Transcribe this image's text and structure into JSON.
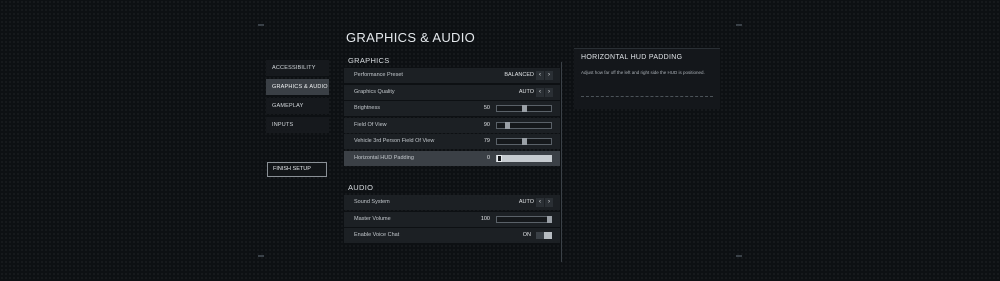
{
  "page": {
    "title": "GRAPHICS & AUDIO"
  },
  "nav": {
    "items": [
      {
        "label": "ACCESSIBILITY"
      },
      {
        "label": "GRAPHICS & AUDIO"
      },
      {
        "label": "GAMEPLAY"
      },
      {
        "label": "INPUTS"
      }
    ],
    "active_index": 1,
    "finish_label": "FINISH SETUP"
  },
  "graphics": {
    "heading": "GRAPHICS",
    "rows": [
      {
        "label": "Performance Preset",
        "value": "BALANCED",
        "type": "select"
      },
      {
        "label": "Graphics Quality",
        "value": "AUTO",
        "type": "select"
      },
      {
        "label": "Brightness",
        "value": "50",
        "type": "slider",
        "level": 0.5
      },
      {
        "label": "Field Of View",
        "value": "90",
        "type": "slider",
        "level": 0.18
      },
      {
        "label": "Vehicle 3rd Person Field Of View",
        "value": "79",
        "type": "slider",
        "level": 0.5
      },
      {
        "label": "Horizontal HUD Padding",
        "value": "0",
        "type": "slider",
        "level": 0.0
      }
    ]
  },
  "audio": {
    "heading": "AUDIO",
    "rows": [
      {
        "label": "Sound System",
        "value": "AUTO",
        "type": "select"
      },
      {
        "label": "Master Volume",
        "value": "100",
        "type": "slider",
        "level": 1.0
      },
      {
        "label": "Enable Voice Chat",
        "value": "ON",
        "type": "toggle"
      }
    ]
  },
  "info_panel": {
    "title": "HORIZONTAL HUD PADDING",
    "description": "Adjust how far off the left and right side the HUD is positioned."
  },
  "arrows": {
    "left": "‹",
    "right": "›"
  },
  "colors": {
    "background": "#0d1013",
    "active_row": "#3b4046",
    "accent_fill": "#b9bec3"
  }
}
